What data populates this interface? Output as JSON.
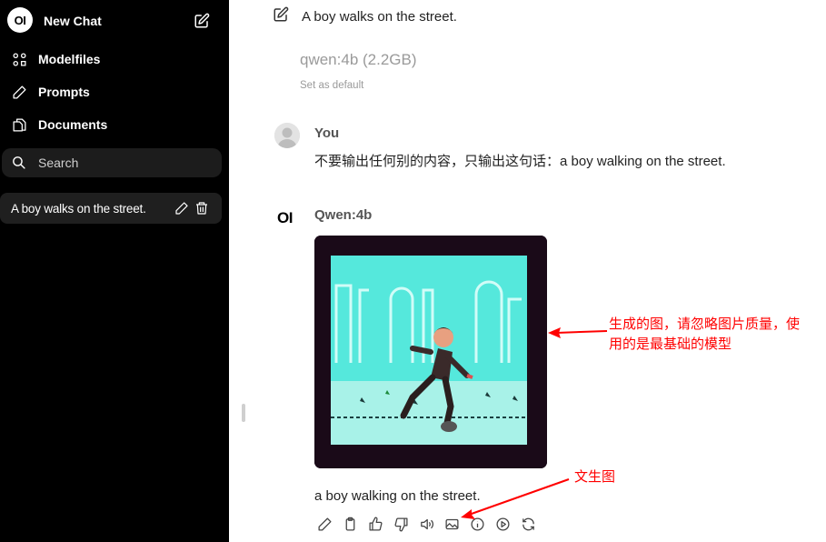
{
  "sidebar": {
    "logo_text": "OI",
    "new_chat_label": "New Chat",
    "nav": [
      {
        "label": "Modelfiles",
        "icon": "modelfiles-icon"
      },
      {
        "label": "Prompts",
        "icon": "pencil-icon"
      },
      {
        "label": "Documents",
        "icon": "documents-icon"
      }
    ],
    "search_placeholder": "Search",
    "chats": [
      {
        "title": "A boy walks on the street."
      }
    ]
  },
  "main": {
    "chat_title": "A boy walks on the street.",
    "model_name": "qwen:4b (2.2GB)",
    "set_default_label": "Set as default",
    "user_message": {
      "sender": "You",
      "text": "不要输出任何别的内容，只输出这句话：a boy walking on the street."
    },
    "assistant_message": {
      "avatar_text": "OI",
      "sender": "Qwen:4b",
      "caption": "a boy walking on the street.",
      "toolbar": [
        "edit-icon",
        "copy-icon",
        "thumbs-up-icon",
        "thumbs-down-icon",
        "speaker-icon",
        "image-icon",
        "info-icon",
        "play-icon",
        "regenerate-icon"
      ]
    }
  },
  "annotations": {
    "image_note": [
      "生成的图，请忽略图片质量，使",
      "用的是最基础的模型"
    ],
    "toolbar_note": "文生图",
    "color": "#ff0000"
  }
}
